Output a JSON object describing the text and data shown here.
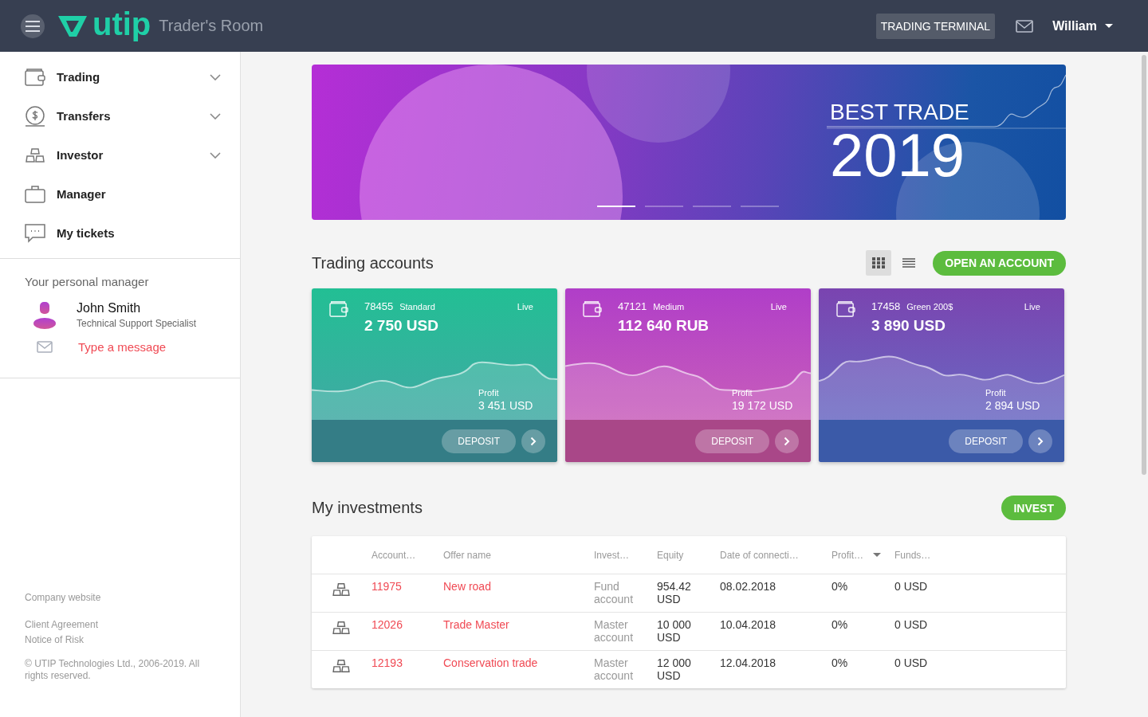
{
  "header": {
    "logo": "utip",
    "title": "Trader's Room",
    "terminal_button": "TRADING TERMINAL",
    "user": "William"
  },
  "sidebar": {
    "items": [
      {
        "label": "Trading",
        "expandable": true
      },
      {
        "label": "Transfers",
        "expandable": true
      },
      {
        "label": "Investor",
        "expandable": true
      },
      {
        "label": "Manager",
        "expandable": false
      },
      {
        "label": "My tickets",
        "expandable": false
      }
    ],
    "manager_heading": "Your personal manager",
    "manager_name": "John Smith",
    "manager_role": "Technical Support Specialist",
    "message_link": "Type a message",
    "footer_links": [
      "Company website",
      "Client Agreement",
      "Notice of Risk"
    ],
    "copyright": "© UTIP Technologies Ltd., 2006-2019. All rights reserved."
  },
  "banner": {
    "heading": "BEST TRADE",
    "year": "2019",
    "indicators": [
      {
        "selected": true
      },
      {
        "selected": false
      },
      {
        "selected": false
      },
      {
        "selected": false
      }
    ]
  },
  "trading_accounts": {
    "title": "Trading accounts",
    "views": [
      {
        "kind": "grid",
        "selected": true
      },
      {
        "kind": "list",
        "selected": false
      }
    ],
    "open_button": "OPEN AN ACCOUNT",
    "cards": [
      {
        "kind": "teal",
        "number": "78455",
        "type": "Standard",
        "status": "Live",
        "balance": "2 750 USD",
        "profit_label": "Profit",
        "profit": "3 451 USD",
        "deposit": "DEPOSIT"
      },
      {
        "kind": "magenta",
        "number": "47121",
        "type": "Medium",
        "status": "Live",
        "balance": "112 640 RUB",
        "profit_label": "Profit",
        "profit": "19 172 USD",
        "deposit": "DEPOSIT"
      },
      {
        "kind": "violet",
        "number": "17458",
        "type": "Green 200$",
        "status": "Live",
        "balance": "3 890 USD",
        "profit_label": "Profit",
        "profit": "2 894 USD",
        "deposit": "DEPOSIT"
      }
    ]
  },
  "investments": {
    "title": "My investments",
    "invest_button": "INVEST",
    "columns": [
      {
        "label": "Account…",
        "sorted": false
      },
      {
        "label": "Offer name",
        "sorted": false
      },
      {
        "label": "Invest…",
        "sorted": false
      },
      {
        "label": "Equity",
        "sorted": false
      },
      {
        "label": "Date of connecti…",
        "sorted": false
      },
      {
        "label": "Profit…",
        "sorted": true
      },
      {
        "label": "Funds…",
        "sorted": false
      }
    ],
    "rows": [
      {
        "account": "11975",
        "offer": "New road",
        "type": "Fund account",
        "equity": "954.42 USD",
        "date": "08.02.2018",
        "profit": "0%",
        "funds": "0 USD"
      },
      {
        "account": "12026",
        "offer": "Trade Master",
        "type": "Master account",
        "equity": "10 000 USD",
        "date": "10.04.2018",
        "profit": "0%",
        "funds": "0 USD"
      },
      {
        "account": "12193",
        "offer": "Conservation trade",
        "type": "Master account",
        "equity": "12 000 USD",
        "date": "12.04.2018",
        "profit": "0%",
        "funds": "0 USD"
      }
    ]
  }
}
